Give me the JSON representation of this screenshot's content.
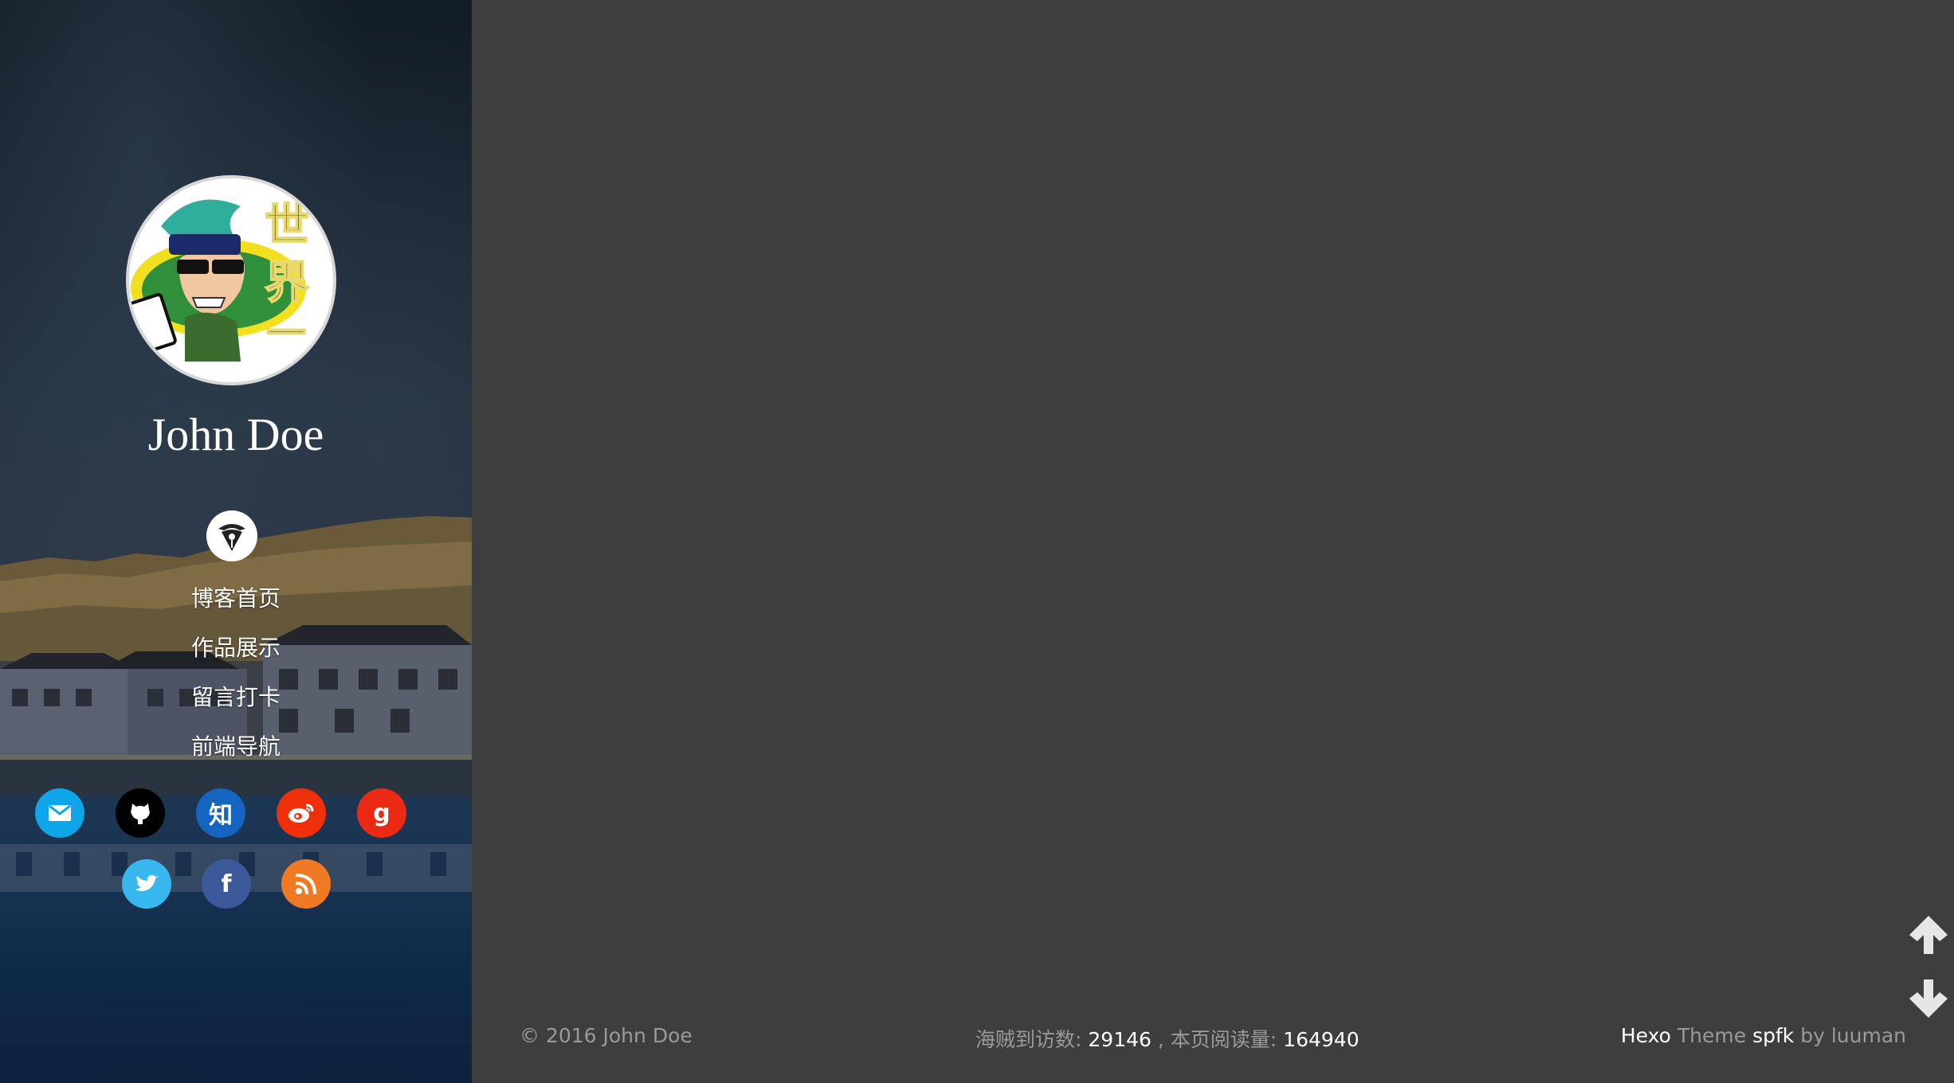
{
  "sidebar": {
    "author_name": "John Doe",
    "nav": [
      {
        "label": "博客首页"
      },
      {
        "label": "作品展示"
      },
      {
        "label": "留言打卡"
      },
      {
        "label": "前端导航"
      }
    ],
    "social": [
      {
        "name": "mail-icon",
        "glyph": "",
        "color": "#0ea5e9"
      },
      {
        "name": "github-icon",
        "glyph": "",
        "color": "#000000"
      },
      {
        "name": "zhihu-icon",
        "glyph": "知",
        "color": "#1565c0"
      },
      {
        "name": "weibo-icon",
        "glyph": "",
        "color": "#f0300a"
      },
      {
        "name": "google-icon",
        "glyph": "g",
        "color": "#ea2a15"
      },
      {
        "name": "twitter-icon",
        "glyph": "",
        "color": "#38b6ee"
      },
      {
        "name": "facebook-icon",
        "glyph": "f",
        "color": "#3b5999"
      },
      {
        "name": "rss-icon",
        "glyph": "",
        "color": "#ef7a23"
      }
    ]
  },
  "footer": {
    "copyright": "© 2016 John Doe",
    "visits_label": "海贼到访数:",
    "visits_value": "29146",
    "separator": ",",
    "reads_label": "本页阅读量:",
    "reads_value": "164940",
    "theme_prefix": "Hexo",
    "theme_word": "Theme",
    "theme_name": "spfk",
    "theme_by": "by",
    "theme_author": "luuman"
  },
  "colors": {
    "main_background": "#3e3e3e",
    "footer_text": "#9a9a9a"
  }
}
